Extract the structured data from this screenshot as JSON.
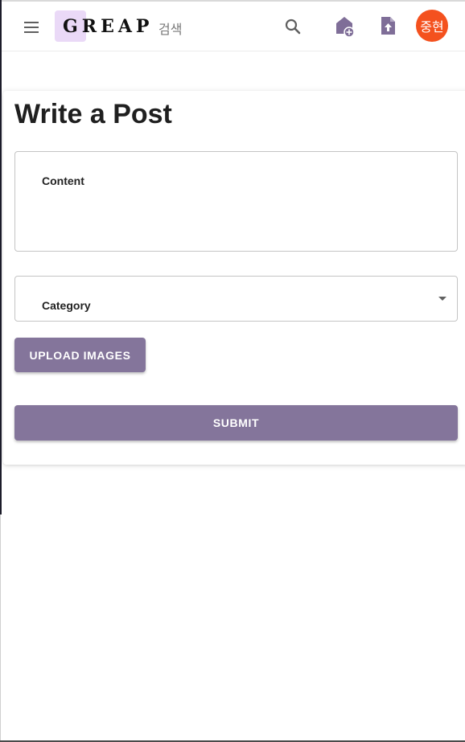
{
  "header": {
    "logo_text": "GREAP",
    "search_hint": "검색",
    "avatar_initials": "중현",
    "icons": [
      "menu-icon",
      "search-icon",
      "home-add-icon",
      "file-upload-icon"
    ]
  },
  "form": {
    "title": "Write a Post",
    "content_label": "Content",
    "content_value": "",
    "category_label": "Category",
    "category_value": "",
    "upload_label": "UPLOAD IMAGES",
    "submit_label": "SUBMIT"
  },
  "colors": {
    "primary_button": "#84759b",
    "avatar": "#f4511e",
    "logo_highlight": "#ead9f7",
    "icon_purple": "#7f6e98"
  }
}
